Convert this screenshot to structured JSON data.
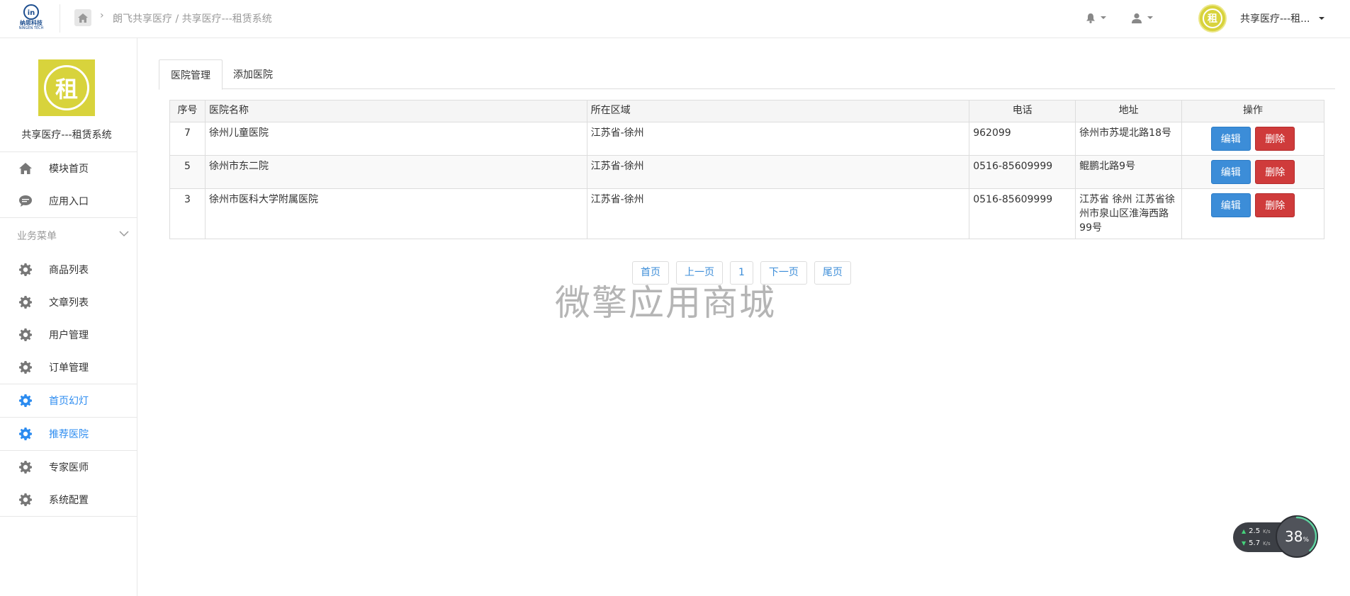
{
  "header": {
    "logo_text": "纳思科技",
    "logo_sub": "NINGEN TECH",
    "breadcrumb": "朗飞共享医疗 / 共享医疗---租赁系统",
    "user_name": "共享医疗---租...",
    "avatar_char": "租"
  },
  "sidebar": {
    "logo_char": "租",
    "title": "共享医疗---租赁系统",
    "top_items": [
      {
        "label": "模块首页",
        "icon": "home-icon"
      },
      {
        "label": "应用入口",
        "icon": "chat-icon"
      }
    ],
    "group_label": "业务菜单",
    "group_items": [
      {
        "label": "商品列表",
        "icon": "gear-icon"
      },
      {
        "label": "文章列表",
        "icon": "gear-icon"
      },
      {
        "label": "用户管理",
        "icon": "gear-icon"
      },
      {
        "label": "订单管理",
        "icon": "gear-icon"
      },
      {
        "label": "首页幻灯",
        "icon": "gear-icon"
      },
      {
        "label": "推荐医院",
        "icon": "gear-icon"
      },
      {
        "label": "专家医师",
        "icon": "gear-icon"
      },
      {
        "label": "系统配置",
        "icon": "gear-icon"
      }
    ]
  },
  "tabs": [
    {
      "label": "医院管理",
      "active": true
    },
    {
      "label": "添加医院",
      "active": false
    }
  ],
  "table": {
    "headers": [
      "序号",
      "医院名称",
      "所在区域",
      "电话",
      "地址",
      "操作"
    ],
    "rows": [
      {
        "id": "7",
        "name": "徐州儿童医院",
        "region": "江苏省-徐州",
        "phone": "962099",
        "address": "徐州市苏堤北路18号"
      },
      {
        "id": "5",
        "name": "徐州市东二院",
        "region": "江苏省-徐州",
        "phone": "0516-85609999",
        "address": "鲲鹏北路9号"
      },
      {
        "id": "3",
        "name": "徐州市医科大学附属医院",
        "region": "江苏省-徐州",
        "phone": "0516-85609999",
        "address": "江苏省 徐州 江苏省徐州市泉山区淮海西路99号"
      }
    ],
    "edit_label": "编辑",
    "delete_label": "删除"
  },
  "pager": {
    "first": "首页",
    "prev": "上一页",
    "current": "1",
    "next": "下一页",
    "last": "尾页"
  },
  "watermark": "微擎应用商城",
  "speed_widget": {
    "up": "2.5",
    "down": "5.7",
    "unit": "K/s",
    "percent": "38",
    "percent_sign": "%"
  },
  "colors": {
    "accent": "#2d8cf0",
    "edit": "#3c8dd8",
    "delete": "#cf3b3b",
    "brand_yellow": "#d8d33c"
  }
}
